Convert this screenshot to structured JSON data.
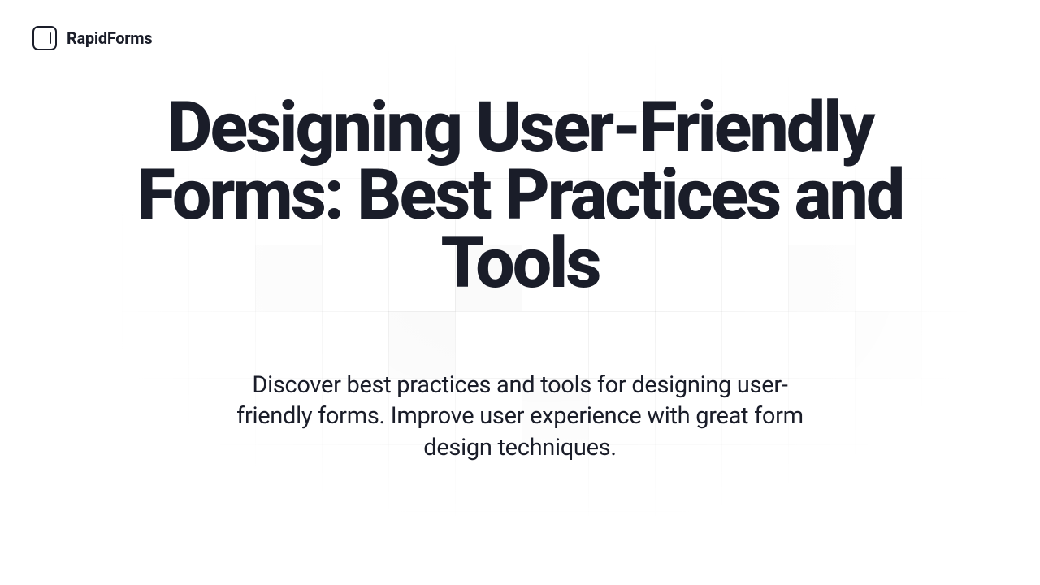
{
  "header": {
    "brand": "RapidForms"
  },
  "hero": {
    "title": "Designing User-Friendly Forms: Best Practices and Tools",
    "subtitle": "Discover best practices and tools for designing user-friendly forms. Improve user experience with great form design techniques."
  }
}
